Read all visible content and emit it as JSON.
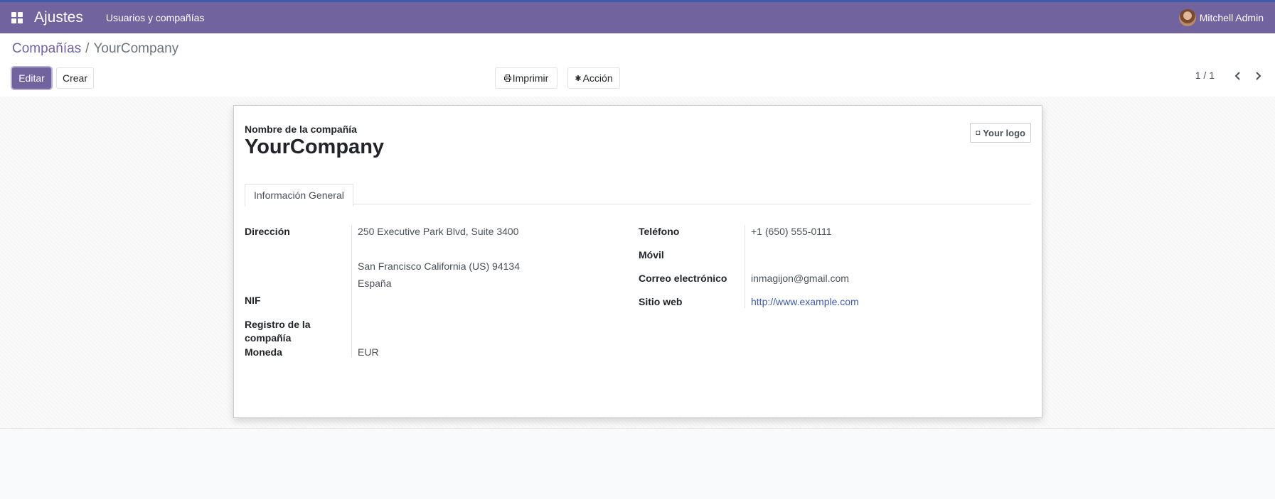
{
  "topbar": {
    "app_name": "Ajustes",
    "menu_item": "Usuarios y compañías",
    "user_name": "Mitchell Admin",
    "colors": {
      "bar": "#71639e",
      "accent_line": "#3d5aa8"
    }
  },
  "breadcrumb": {
    "parent": "Compañías",
    "separator": "/",
    "current": "YourCompany"
  },
  "buttons": {
    "edit": "Editar",
    "create": "Crear",
    "print": "Imprimir",
    "action": "Acción"
  },
  "icons": {
    "print": "printer-icon",
    "action": "gear-icon",
    "logo": "camera-icon",
    "prev": "chevron-left-icon",
    "next": "chevron-right-icon",
    "apps": "grid-icon"
  },
  "pager": {
    "text": "1 / 1",
    "prev": "‹",
    "next": "›"
  },
  "form": {
    "name_label": "Nombre de la compañía",
    "name_value": "YourCompany",
    "logo_label": "Your logo",
    "tab_label": "Información General",
    "left": {
      "address_label": "Dirección",
      "address_street": "250 Executive Park Blvd, Suite 3400",
      "address_city_line": "San Francisco  California (US)  94134",
      "address_country": "España",
      "vat_label": "NIF",
      "company_registry_label": "Registro de la compañía",
      "currency_label": "Moneda",
      "currency_value": "EUR"
    },
    "right": {
      "phone_label": "Teléfono",
      "phone_value": "+1 (650) 555-0111",
      "mobile_label": "Móvil",
      "email_label": "Correo electrónico",
      "email_value": "inmagijon@gmail.com",
      "website_label": "Sitio web",
      "website_value": "http://www.example.com"
    }
  }
}
